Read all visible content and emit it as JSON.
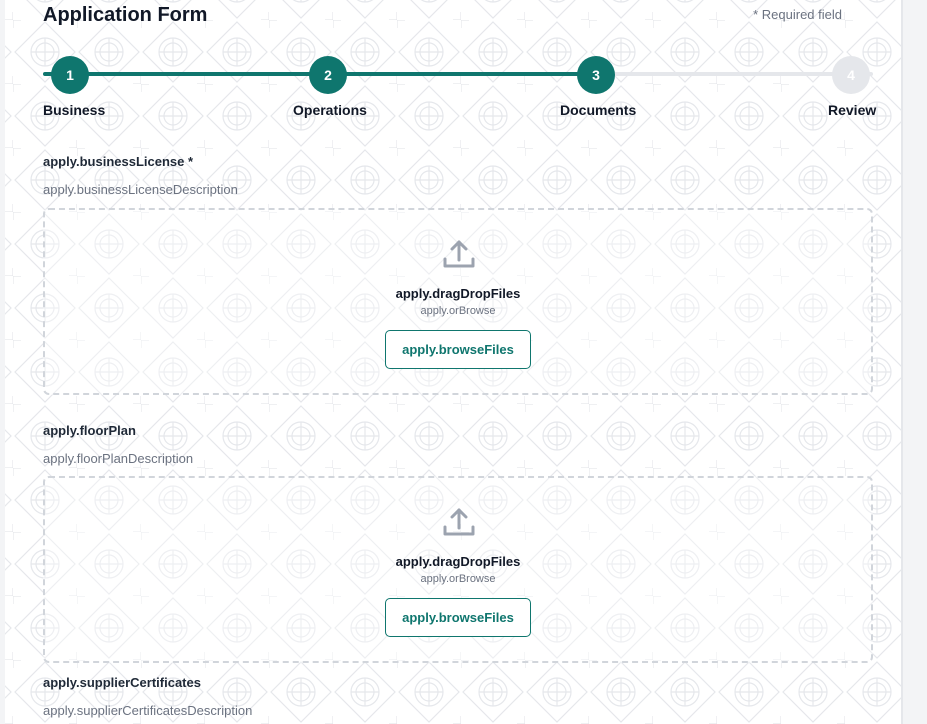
{
  "form": {
    "title": "Application Form",
    "required_note": "* Required field"
  },
  "stepper": {
    "active_color": "#0f766e",
    "inactive_color": "#e5e7eb",
    "steps": [
      {
        "number": "1",
        "label": "Business",
        "state": "completed"
      },
      {
        "number": "2",
        "label": "Operations",
        "state": "completed"
      },
      {
        "number": "3",
        "label": "Documents",
        "state": "current"
      },
      {
        "number": "4",
        "label": "Review",
        "state": "upcoming"
      }
    ]
  },
  "sections": [
    {
      "label": "apply.businessLicense *",
      "description": "apply.businessLicenseDescription",
      "drop_title": "apply.dragDropFiles",
      "drop_sub": "apply.orBrowse",
      "browse_label": "apply.browseFiles",
      "icon": "upload-icon"
    },
    {
      "label": "apply.floorPlan",
      "description": "apply.floorPlanDescription",
      "drop_title": "apply.dragDropFiles",
      "drop_sub": "apply.orBrowse",
      "browse_label": "apply.browseFiles",
      "icon": "upload-icon"
    },
    {
      "label": "apply.supplierCertificates",
      "description": "apply.supplierCertificatesDescription"
    }
  ]
}
